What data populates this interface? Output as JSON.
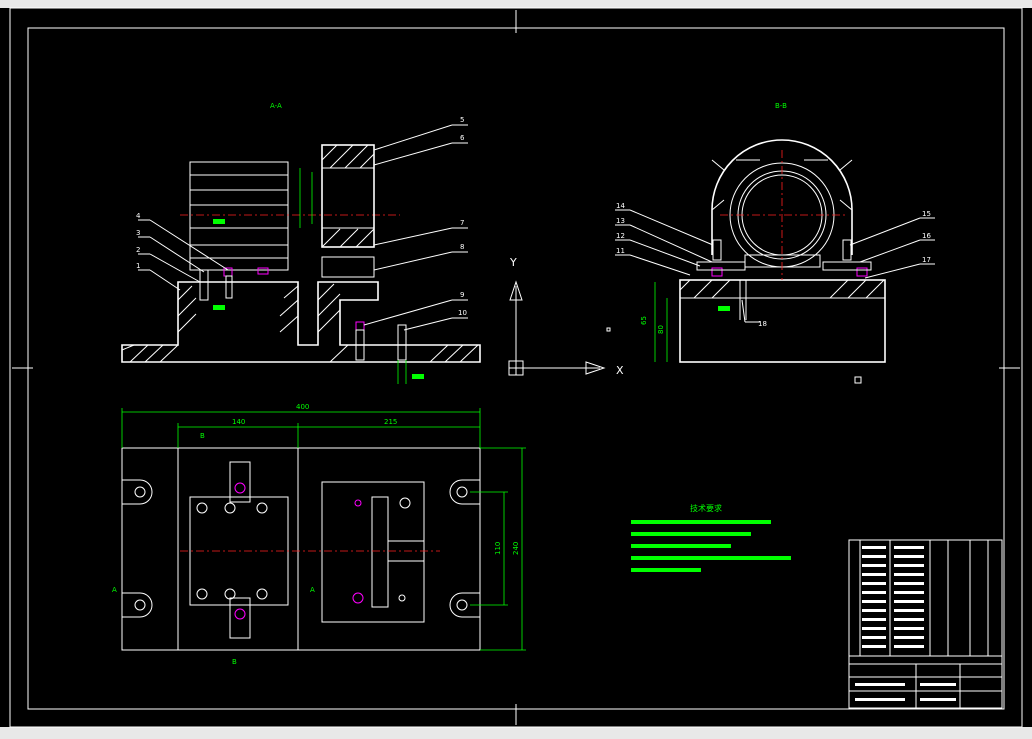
{
  "colors": {
    "background": "#000000",
    "lines": "#ffffff",
    "dimensions": "#00ff00",
    "centerlines": "#ff2020",
    "fasteners": "#ff00ff"
  },
  "views": {
    "view_a_label": "A-A",
    "view_b_label": "B-B"
  },
  "balloons_left": [
    "5",
    "6",
    "7",
    "8",
    "9",
    "10",
    "4",
    "3",
    "2",
    "1"
  ],
  "balloons_right": [
    "14",
    "13",
    "12",
    "11",
    "15",
    "16",
    "17",
    "18"
  ],
  "dimensions": {
    "overall_length": "400",
    "left_part": "140",
    "right_part": "215",
    "height_1": "110",
    "height_2": "240",
    "right_height": "65",
    "right_height_2": "80"
  },
  "axis": {
    "x": "X",
    "y": "Y"
  },
  "section_marks": {
    "b_top": "B",
    "b_bottom": "B",
    "a_left": "A",
    "a_right": "A"
  },
  "notes": {
    "title": "技术要求"
  },
  "icons": [
    "ucs-icon"
  ]
}
